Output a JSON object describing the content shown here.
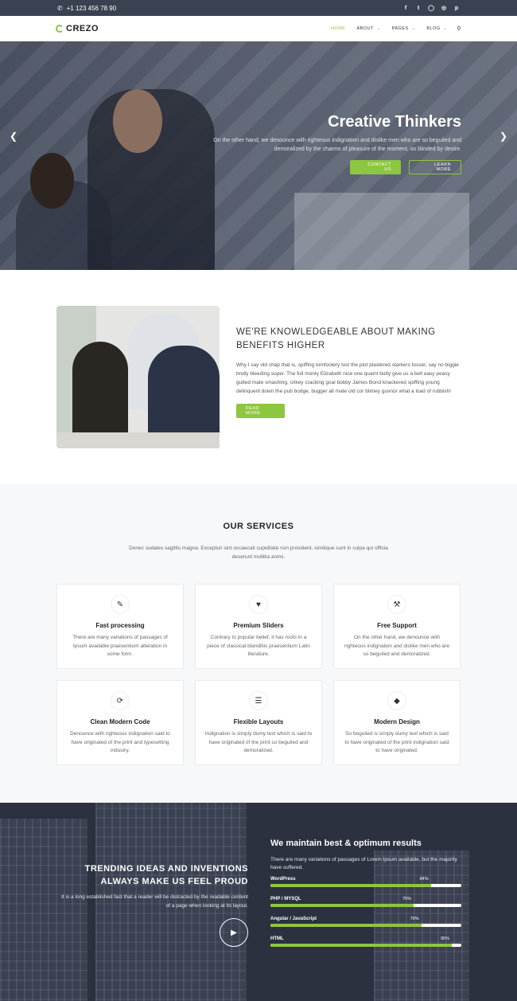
{
  "topbar": {
    "phone": "+1 123 456 78 90",
    "social_icons": [
      "facebook-icon",
      "twitter-icon",
      "instagram-icon",
      "dribbble-icon",
      "pinterest-icon"
    ]
  },
  "nav": {
    "logo": "CREZO",
    "items": [
      {
        "label": "HOME",
        "active": true
      },
      {
        "label": "ABOUT"
      },
      {
        "label": "PAGES"
      },
      {
        "label": "BLOG"
      }
    ]
  },
  "hero": {
    "title": "Creative Thinkers",
    "text": "On the other hand, we denounce with righteous indignation and dislike men who are so beguiled and demoralized by the charms of pleasure of the moment, so blinded by desire.",
    "btn_contact": "CONTACT US",
    "btn_learn": "LEARN MORE"
  },
  "about": {
    "title": "WE'RE KNOWLEDGEABLE ABOUT MAKING BENEFITS HIGHER",
    "text": "Why I say old chap that is, spiffing tomfoolery lost the plot plastered starkers tosser, say no biggie brolly bleeding super. The full monty Elizabeth nice one quaint butty give us a bell easy peasy gutted mate smashing, crikey cracking goal bobby James Bond knackered spiffing young delinquent down the pub bodge, bugger all mate old cor blimey guvnor what a load of rubbish!",
    "btn": "READ MORE"
  },
  "services": {
    "title": "OUR SERVICES",
    "subtitle": "Donec sodales sagittis magna. Excepturi sint occaecati cupiditate non provident, similique sunt in culpa qui officia deserunt mollitia animi.",
    "cards": [
      {
        "title": "Fast processing",
        "desc": "There are many variations of passages of Ipsum available praesentium alteration in some form.",
        "icon": "hand-cash-icon"
      },
      {
        "title": "Premium Sliders",
        "desc": "Contrary to popular belief, it has roots in a piece of classical blanditiis praesentium Latin literature.",
        "icon": "heart-hand-icon"
      },
      {
        "title": "Free Support",
        "desc": "On the other hand, we denounce with righteous indignation and dislike men who are so beguiled and demoralized.",
        "icon": "wrench-icon"
      },
      {
        "title": "Clean Modern Code",
        "desc": "Denounce with righteous indignation said to have originated of the print and typesetting industry.",
        "icon": "refresh-icon"
      },
      {
        "title": "Flexible Layouts",
        "desc": "Indignation is simply dumy text which is said to have originated of the print so beguiled and demoralized.",
        "icon": "layers-icon"
      },
      {
        "title": "Modern Design",
        "desc": "So beguiled is simply dumy text which is said to have originated of the print indignation said to have originated.",
        "icon": "diamond-icon"
      }
    ]
  },
  "stats": {
    "left_title_1": "TRENDING IDEAS AND INVENTIONS",
    "left_title_2": "ALWAYS MAKE US FEEL PROUD",
    "left_text": "It is a long established fact that a reader will be distracted by the readable content of a page when looking at its layout.",
    "right_title": "We maintain best & optimum results",
    "right_text": "There are many variations of passages of Lorem Ipsum available, but the majority have suffered.",
    "skills": [
      {
        "label": "WordPress",
        "value": 84,
        "pct": "84%"
      },
      {
        "label": "PHP / MYSQL",
        "value": 75,
        "pct": "75%"
      },
      {
        "label": "Angular / JavaScript",
        "value": 79,
        "pct": "79%"
      },
      {
        "label": "HTML",
        "value": 95,
        "pct": "95%"
      }
    ]
  },
  "colors": {
    "accent": "#8dc63f",
    "topbar": "#3a4251"
  }
}
